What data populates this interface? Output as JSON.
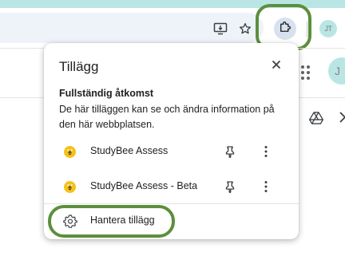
{
  "toolbar": {
    "download_icon": "install-icon",
    "bookmark_icon": "star-icon",
    "extensions_icon": "puzzle-icon",
    "profile_initials": "JT"
  },
  "page": {
    "avatar_initials": "J",
    "apps_icon": "grid-icon",
    "drive_icon": "drive-icon"
  },
  "popup": {
    "title": "Tillägg",
    "close_icon": "close-icon",
    "section_heading": "Fullständig åtkomst",
    "section_desc": "De här tilläggen kan se och ändra information på den här webbplatsen.",
    "extensions": [
      {
        "name": "StudyBee Assess"
      },
      {
        "name": "StudyBee Assess - Beta"
      }
    ],
    "manage_label": "Hantera tillägg"
  },
  "colors": {
    "highlight": "#5c8f3b",
    "accent_strip": "#b9e6e5",
    "extension_logo": "#f5c21b"
  }
}
